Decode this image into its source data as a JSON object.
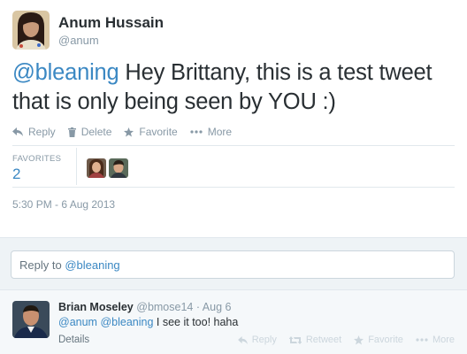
{
  "tweet": {
    "author_name": "Anum Hussain",
    "author_handle": "@anum",
    "text_mention": "@bleaning",
    "text_body": " Hey Brittany, this is a test tweet that is only being seen by YOU :)",
    "actions": {
      "reply": "Reply",
      "delete": "Delete",
      "favorite": "Favorite",
      "more": "More"
    },
    "favorites_label": "FAVORITES",
    "favorites_count": "2",
    "timestamp": "5:30 PM - 6 Aug 2013"
  },
  "reply_box": {
    "prefix": "Reply to ",
    "mention": "@bleaning"
  },
  "reply": {
    "author_name": "Brian Moseley",
    "meta": "@bmose14 · Aug 6",
    "mention1": "@anum",
    "mention2": "@bleaning",
    "text": " I see it too! haha",
    "details": "Details",
    "actions": {
      "reply": "Reply",
      "retweet": "Retweet",
      "favorite": "Favorite",
      "more": "More"
    }
  },
  "colors": {
    "link": "#3b88c3",
    "muted": "#8899a6",
    "reply_bg": "#eef3f6"
  },
  "icons": [
    "reply-icon",
    "trash-icon",
    "star-icon",
    "more-icon",
    "retweet-icon"
  ]
}
